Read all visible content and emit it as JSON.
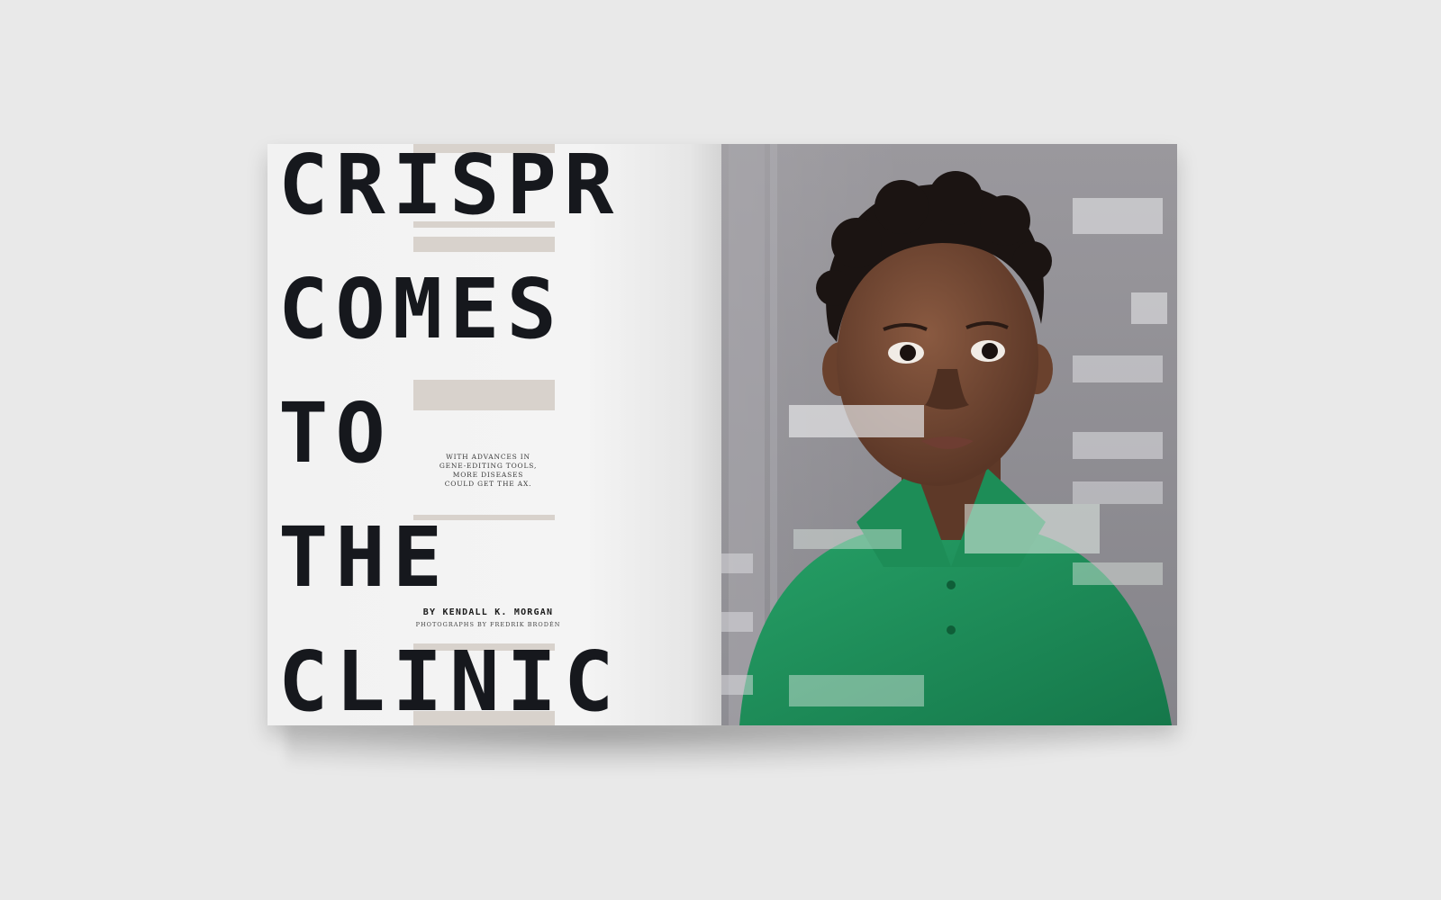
{
  "spread": {
    "headline": [
      "CRISPR",
      "COMES",
      "TO",
      "THE",
      "CLINIC"
    ],
    "dek": "WITH ADVANCES IN\nGENE-EDITING TOOLS,\nMORE DISEASES\nCOULD GET THE AX.",
    "byline": "BY KENDALL K. MORGAN",
    "photo_credit": "PHOTOGRAPHS BY FREDRIK BRODÉN"
  },
  "colors": {
    "background": "#e9e9e9",
    "headline": "#16181d",
    "accent_bar": "#d8d2cc",
    "shirt": "#1f8a55",
    "skin": "#6b4330"
  }
}
